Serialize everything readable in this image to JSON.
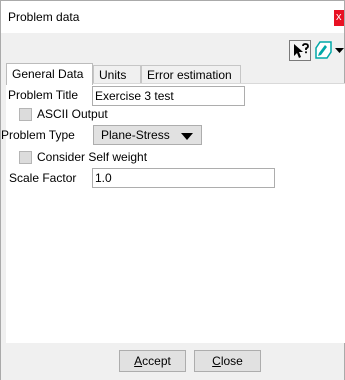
{
  "window": {
    "title": "Problem data",
    "close_glyph": "x"
  },
  "toolbar": {
    "help_icon": "help-pointer-icon",
    "shape_icon": "shape-edit-icon",
    "dropdown_icon": "triangle-down-icon"
  },
  "tabs": [
    {
      "label": "General Data",
      "active": true
    },
    {
      "label": "Units",
      "active": false
    },
    {
      "label": "Error estimation",
      "active": false
    }
  ],
  "form": {
    "problem_title_label": "Problem Title",
    "problem_title_value": "Exercise 3 test",
    "ascii_output_label": "ASCII Output",
    "ascii_output_checked": false,
    "problem_type_label": "Problem Type",
    "problem_type_value": "Plane-Stress",
    "self_weight_label": "Consider Self weight",
    "self_weight_checked": false,
    "scale_factor_label": "Scale Factor",
    "scale_factor_value": "1.0"
  },
  "buttons": {
    "accept_mnemonic": "A",
    "accept_rest": "ccept",
    "close_mnemonic": "C",
    "close_rest": "lose"
  },
  "colors": {
    "close_button": "#e81123",
    "dialog_bg": "#f0f0f0",
    "panel_bg": "#ffffff",
    "shape_icon": "#00a8a8"
  }
}
